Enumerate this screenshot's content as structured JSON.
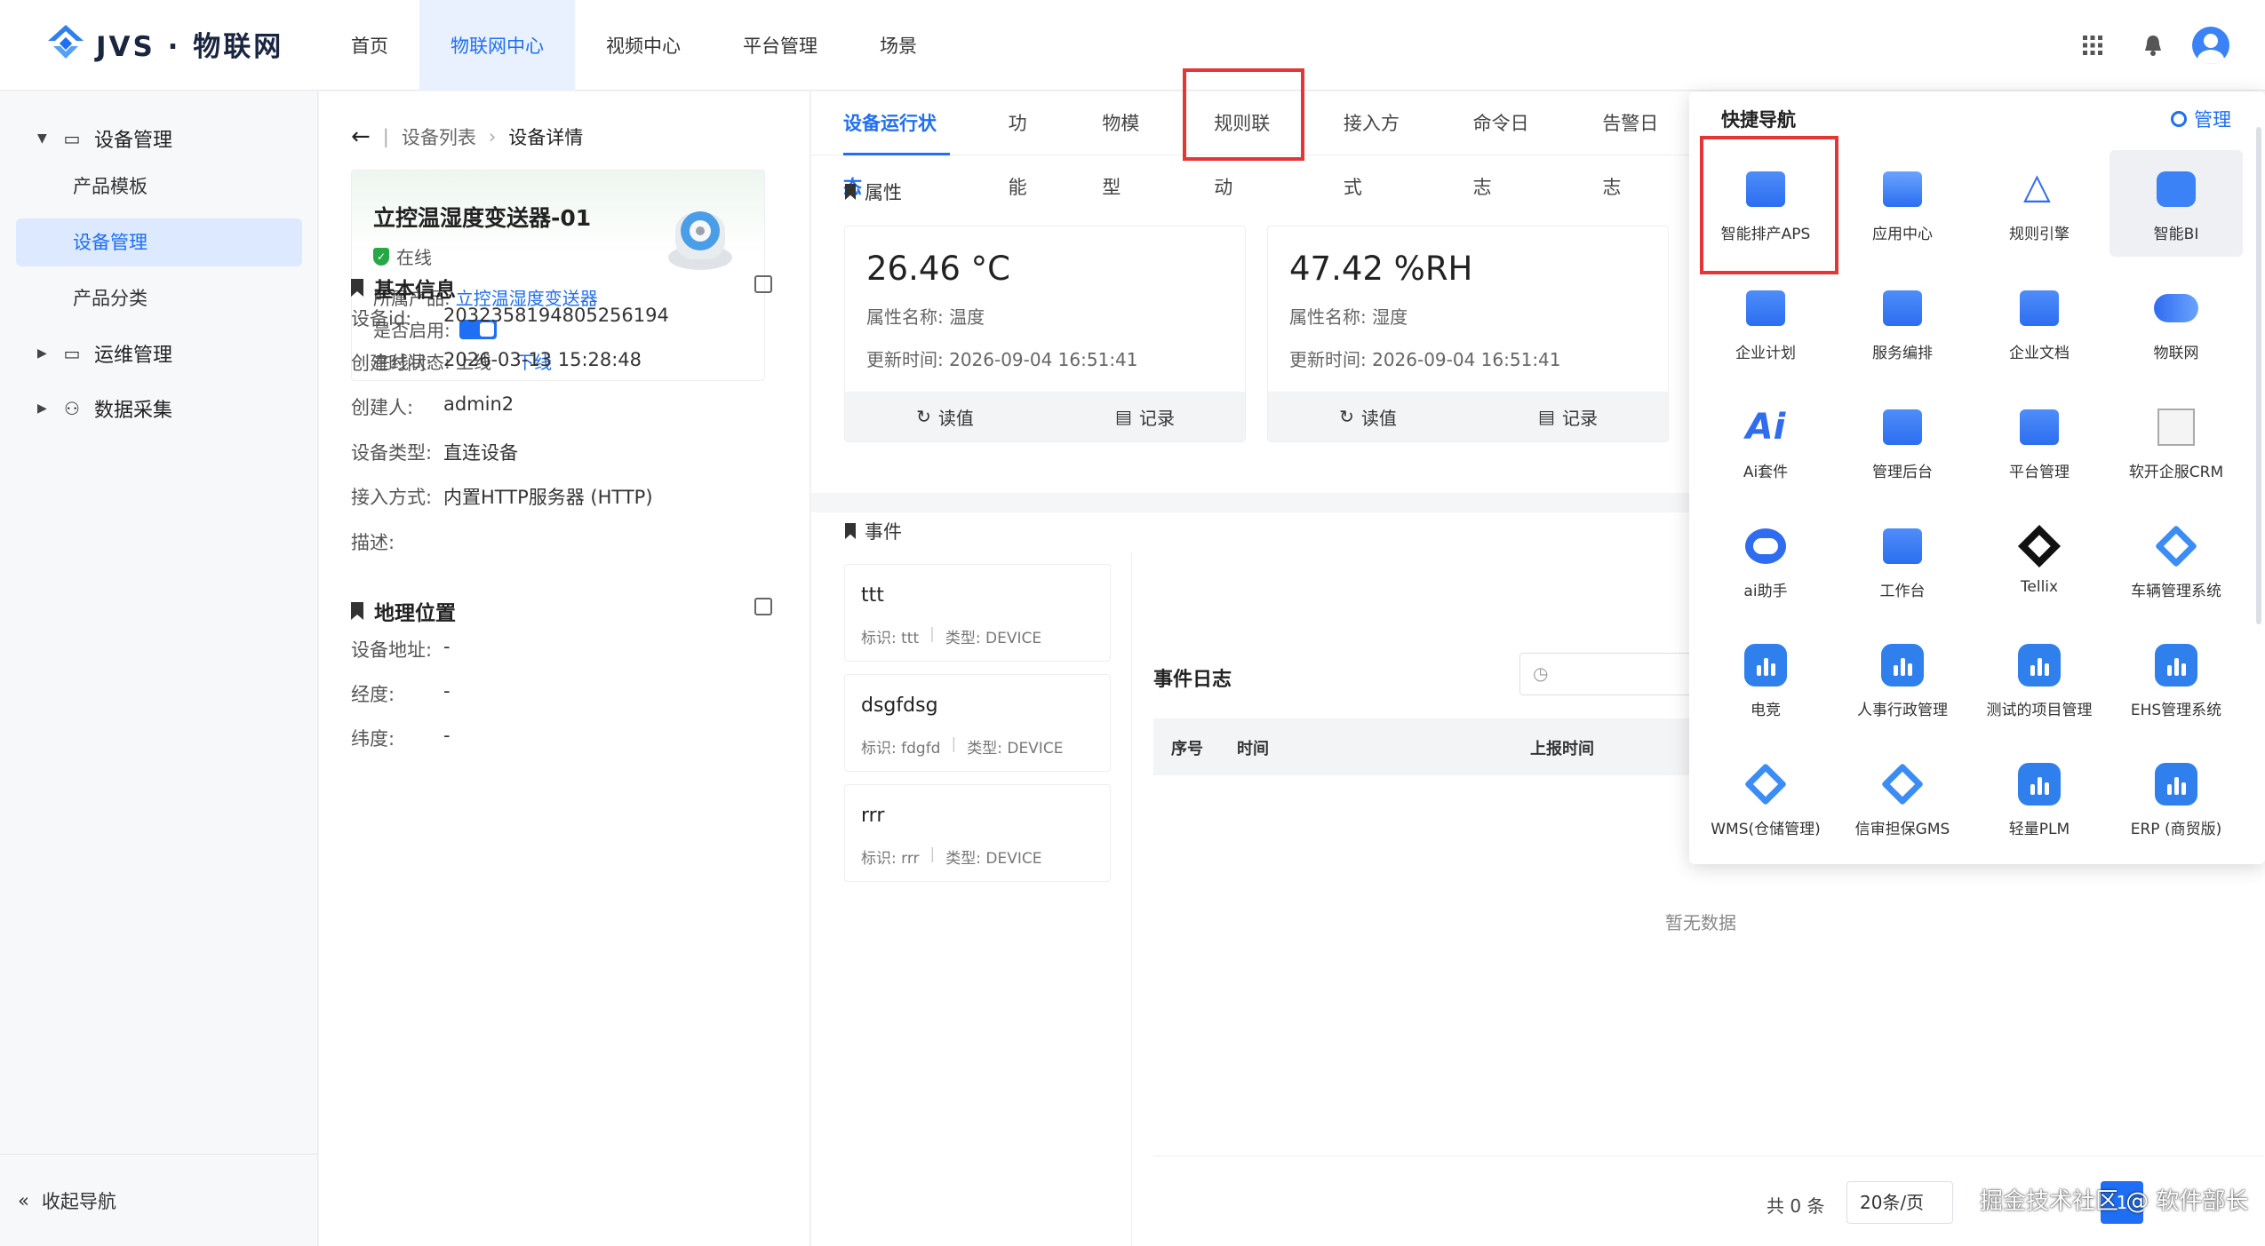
{
  "brand": {
    "name": "JVS · 物联网"
  },
  "topnav": [
    "首页",
    "物联网中心",
    "视频中心",
    "平台管理",
    "场景"
  ],
  "sidebar": {
    "groups": [
      {
        "label": "设备管理",
        "items": [
          "产品模板",
          "设备管理",
          "产品分类"
        ]
      },
      {
        "label": "运维管理"
      },
      {
        "label": "数据采集"
      }
    ],
    "collapse_label": "收起导航"
  },
  "breadcrumb": {
    "parent": "设备列表",
    "current": "设备详情"
  },
  "device": {
    "name": "立控温湿度变送器-01",
    "status": "在线",
    "product_label": "所属产品:",
    "product": "立控温湿度变送器",
    "enabled_label": "是否启用:",
    "online_label": "在线状态: 上线",
    "offline_link": "下线"
  },
  "basic_info": {
    "title": "基本信息",
    "fields": [
      {
        "k": "设备id:",
        "v": "2032358194805256194"
      },
      {
        "k": "创建时间:",
        "v": "2026-03-13 15:28:48"
      },
      {
        "k": "创建人:",
        "v": "admin2"
      },
      {
        "k": "设备类型:",
        "v": "直连设备"
      },
      {
        "k": "接入方式:",
        "v": "内置HTTP服务器 (HTTP)"
      },
      {
        "k": "描述:",
        "v": ""
      }
    ]
  },
  "location": {
    "title": "地理位置",
    "fields": [
      {
        "k": "设备地址:",
        "v": "-"
      },
      {
        "k": "经度:",
        "v": "-"
      },
      {
        "k": "纬度:",
        "v": "-"
      }
    ]
  },
  "tabs": [
    "设备运行状态",
    "功能",
    "物模型",
    "规则联动",
    "接入方式",
    "命令日志",
    "告警日志"
  ],
  "properties": {
    "title": "属性",
    "cards": [
      {
        "value": "26.46 °C",
        "name": "属性名称: 温度",
        "time": "更新时间: 2026-09-04 16:51:41",
        "read": "读值",
        "record": "记录"
      },
      {
        "value": "47.42 %RH",
        "name": "属性名称: 湿度",
        "time": "更新时间: 2026-09-04 16:51:41",
        "read": "读值",
        "record": "记录"
      }
    ]
  },
  "events": {
    "title": "事件",
    "list": [
      {
        "name": "ttt",
        "id": "标识: ttt",
        "type": "类型: DEVICE"
      },
      {
        "name": "dsgfdsg",
        "id": "标识: fdgfd",
        "type": "类型: DEVICE"
      },
      {
        "name": "rrr",
        "id": "标识: rrr",
        "type": "类型: DEVICE"
      }
    ]
  },
  "event_log": {
    "title": "事件日志",
    "columns": [
      "序号",
      "时间",
      "上报时间"
    ],
    "empty": "暂无数据",
    "total": "共 0 条",
    "page_size": "20条/页",
    "page": "1"
  },
  "quick_nav": {
    "title": "快捷导航",
    "manage": "管理",
    "apps": [
      "智能排产APS",
      "应用中心",
      "规则引擎",
      "智能BI",
      "企业计划",
      "服务编排",
      "企业文档",
      "物联网",
      "Ai套件",
      "管理后台",
      "平台管理",
      "软开企服CRM",
      "ai助手",
      "工作台",
      "Tellix",
      "车辆管理系统",
      "电竞",
      "人事行政管理",
      "测试的项目管理",
      "EHS管理系统",
      "WMS(仓储管理)",
      "信审担保GMS",
      "轻量PLM",
      "ERP (商贸版)"
    ]
  },
  "watermark": "掘金技术社区 @ 软件部长",
  "colors": {
    "accent": "#1e6ff5",
    "highlight": "#e53535",
    "online": "#27a847"
  }
}
